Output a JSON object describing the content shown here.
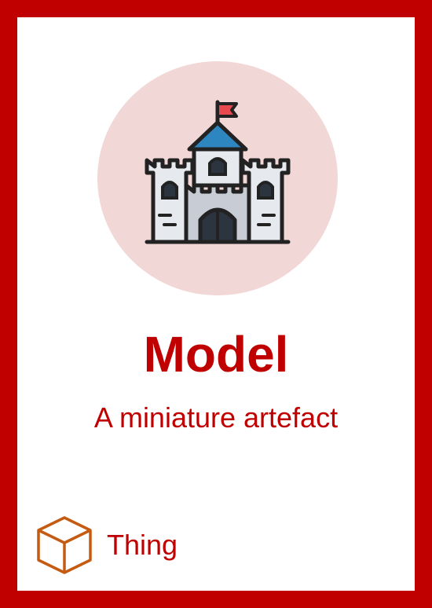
{
  "card": {
    "title": "Model",
    "subtitle": "A miniature artefact",
    "category": "Thing",
    "image_icon": "castle-icon",
    "category_icon": "cube-icon"
  },
  "colors": {
    "accent": "#c00000",
    "emblem_background": "#f2d7d7",
    "cube_outline": "#c55a11",
    "flag": "#e8494f",
    "roof": "#2e86c1",
    "wall": "#e6e9ee",
    "gate": "#2c3440"
  }
}
